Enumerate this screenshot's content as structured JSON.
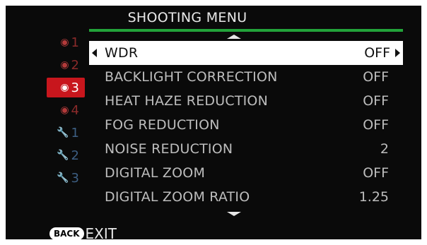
{
  "title": "SHOOTING MENU",
  "tabs": [
    {
      "icon": "camera-icon",
      "number": "1",
      "active": false,
      "kind": "cam"
    },
    {
      "icon": "camera-icon",
      "number": "2",
      "active": false,
      "kind": "cam"
    },
    {
      "icon": "camera-icon",
      "number": "3",
      "active": true,
      "kind": "cam"
    },
    {
      "icon": "camera-icon",
      "number": "4",
      "active": false,
      "kind": "cam"
    },
    {
      "icon": "wrench-icon",
      "number": "1",
      "active": false,
      "kind": "wrench"
    },
    {
      "icon": "wrench-icon",
      "number": "2",
      "active": false,
      "kind": "wrench"
    },
    {
      "icon": "wrench-icon",
      "number": "3",
      "active": false,
      "kind": "wrench"
    }
  ],
  "items": [
    {
      "label": "WDR",
      "value": "OFF",
      "selected": true
    },
    {
      "label": "BACKLIGHT CORRECTION",
      "value": "OFF",
      "selected": false
    },
    {
      "label": "HEAT HAZE REDUCTION",
      "value": "OFF",
      "selected": false
    },
    {
      "label": "FOG REDUCTION",
      "value": "OFF",
      "selected": false
    },
    {
      "label": "NOISE REDUCTION",
      "value": "2",
      "selected": false
    },
    {
      "label": "DIGITAL ZOOM",
      "value": "OFF",
      "selected": false
    },
    {
      "label": "DIGITAL ZOOM RATIO",
      "value": "1.25",
      "selected": false
    }
  ],
  "footer": {
    "back_label": "BACK",
    "exit_label": "EXIT"
  },
  "colors": {
    "accent_green": "#22a33a",
    "active_tab_red": "#c8161d",
    "selection_white": "#ffffff"
  }
}
